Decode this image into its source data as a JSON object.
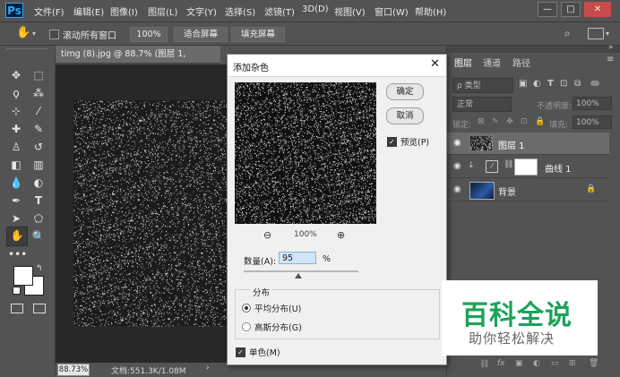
{
  "app": {
    "logo": "Ps"
  },
  "menu": [
    "文件(F)",
    "编辑(E)",
    "图像(I)",
    "图层(L)",
    "文字(Y)",
    "选择(S)",
    "滤镜(T)",
    "3D(D)",
    "视图(V)",
    "窗口(W)",
    "帮助(H)"
  ],
  "window_controls": {
    "minimize": "—",
    "restore": "□",
    "close": "✕"
  },
  "options": {
    "hand_icon": "✋",
    "scroll_all_label": "滚动所有窗口",
    "zoom_btn": "100%",
    "fit_screen_btn": "适合屏幕",
    "fill_screen_btn": "填充屏幕"
  },
  "document": {
    "tab_title": "timg (8).jpg @ 88.7% (图层 1, RGB/8#) *",
    "close": "×"
  },
  "status": {
    "zoom": "88.73%",
    "doc_info": "文档:551.3K/1.08M",
    "arrow": "›"
  },
  "panels": {
    "tabs": [
      "图层",
      "通道",
      "路径"
    ],
    "kind_label": "ρ 类型",
    "blend_mode": "正常",
    "opacity_label": "不透明度:",
    "opacity_value": "100%",
    "lock_label": "锁定:",
    "fill_label": "填充:",
    "fill_value": "100%",
    "layers": [
      {
        "name": "图层 1"
      },
      {
        "name": "曲线 1"
      },
      {
        "name": "背景"
      }
    ]
  },
  "dialog": {
    "title": "添加杂色",
    "ok": "确定",
    "cancel": "取消",
    "preview_label": "预览(P)",
    "zoom_level": "100%",
    "amount_label": "数量(A):",
    "amount_value": "95",
    "amount_unit": "%",
    "amount_level": 0.475,
    "distribution_title": "分布",
    "uniform_label": "平均分布(U)",
    "gaussian_label": "高斯分布(G)",
    "mono_label": "单色(M)"
  },
  "watermark": {
    "title": "百科全说",
    "subtitle": "助你轻松解决"
  },
  "colors": {
    "ui_bg": "#535353",
    "dialog_bg": "#f0f0f0",
    "watermark_green": "#1aa35a",
    "accent": "#31a8ff"
  }
}
